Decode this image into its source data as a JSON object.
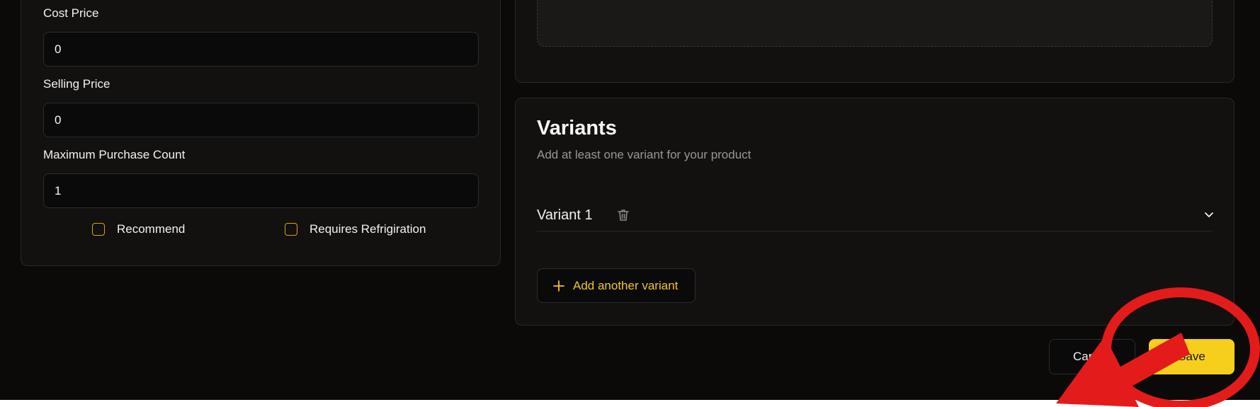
{
  "form": {
    "cost_price": {
      "label": "Cost Price",
      "value": "0"
    },
    "selling_price": {
      "label": "Selling Price",
      "value": "0"
    },
    "max_purchase": {
      "label": "Maximum Purchase Count",
      "value": "1"
    },
    "recommend_label": "Recommend",
    "refrigeration_label": "Requires Refrigiration"
  },
  "variants": {
    "title": "Variants",
    "description": "Add at least one variant for your product",
    "items": [
      {
        "name": "Variant 1"
      }
    ],
    "add_label": "Add another variant"
  },
  "actions": {
    "cancel_label": "Cancel",
    "save_label": "Save"
  },
  "colors": {
    "accent": "#f6cf1d",
    "annotation": "#e41b1b",
    "background": "#0b0a09"
  },
  "icons": [
    "trash-icon",
    "chevron-down-icon",
    "plus-icon"
  ]
}
